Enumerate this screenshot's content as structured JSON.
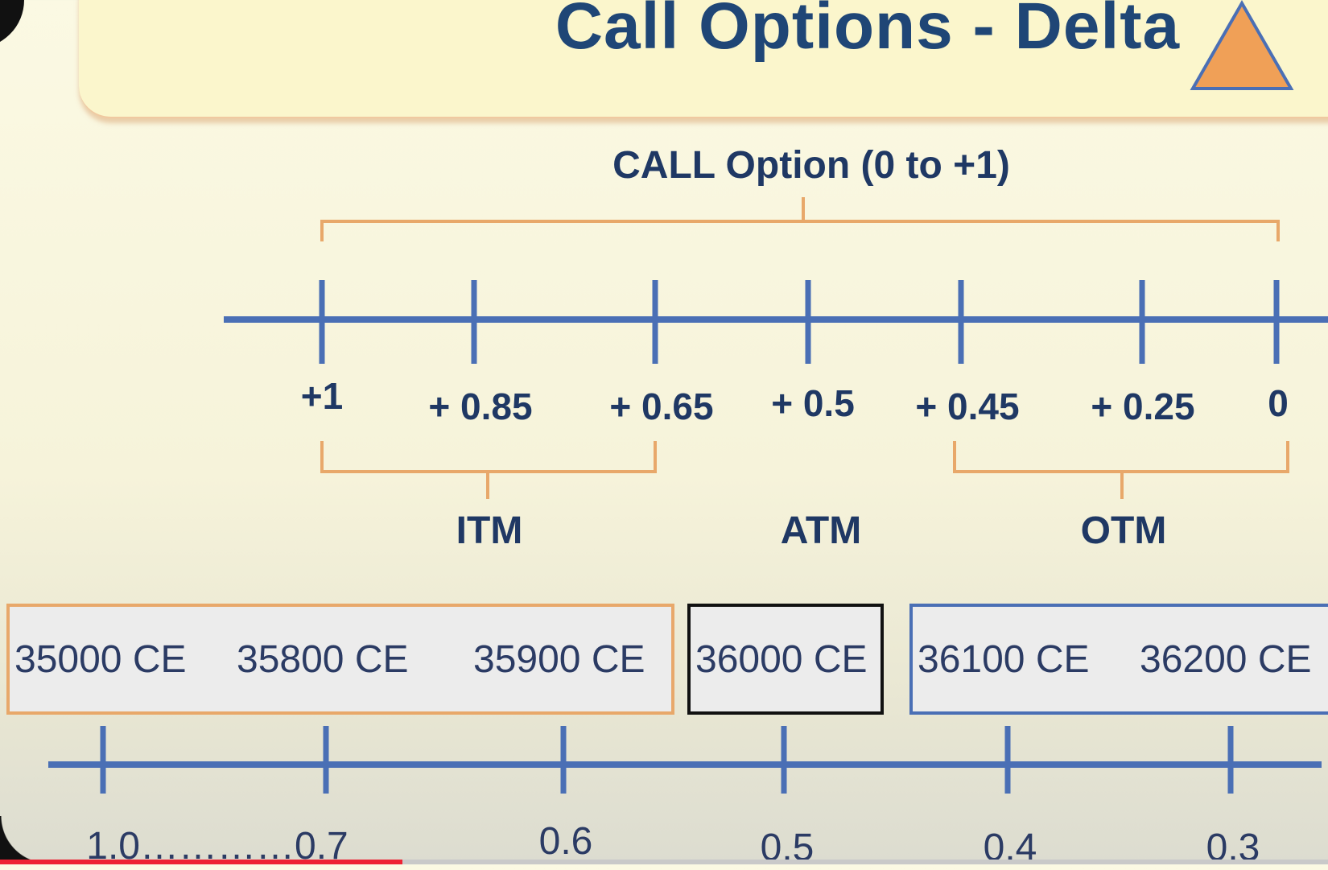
{
  "title": "Call Options - Delta",
  "range_label": "CALL Option (0 to +1)",
  "delta_ticks": [
    "+1",
    "+ 0.85",
    "+ 0.65",
    "+ 0.5",
    "+ 0.45",
    "+ 0.25",
    "0"
  ],
  "zones": {
    "itm": "ITM",
    "atm": "ATM",
    "otm": "OTM"
  },
  "strikes": {
    "itm": [
      "35000 CE",
      "35800 CE",
      "35900 CE"
    ],
    "atm": [
      "36000 CE"
    ],
    "otm": [
      "36100 CE",
      "36200 CE"
    ]
  },
  "scale_labels": [
    "1.0…………0.7",
    "0.6",
    "0.5",
    "0.4",
    "0.3"
  ],
  "colors": {
    "navy": "#1f3864",
    "axis_blue": "#4a6fb5",
    "orange": "#e8a86a",
    "triangle": "#f0a057",
    "title_bg": "#fbf6cc"
  },
  "icons": {
    "delta": "triangle-icon"
  }
}
